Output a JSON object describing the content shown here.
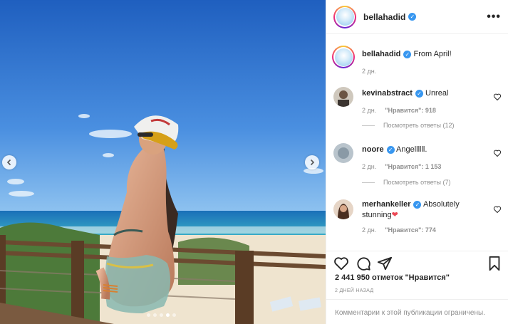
{
  "post": {
    "username": "bellahadid",
    "caption": "From April!",
    "caption_time": "2 дн.",
    "likes": "2 441 950 отметок \"Нравится\"",
    "posted_ago": "2 ДНЕЙ НАЗАД",
    "comments_disabled": "Комментарии к этой публикации ограничены.",
    "carousel": {
      "count": 5,
      "active_index": 3
    }
  },
  "comments": [
    {
      "username": "kevinabstract",
      "text": "Unreal",
      "time": "2 дн.",
      "likes": "\"Нравится\": 918",
      "replies": "Посмотреть ответы (12)"
    },
    {
      "username": "noore",
      "text": "Angellllll.",
      "time": "2 дн.",
      "likes": "\"Нравится\": 1 153",
      "replies": "Посмотреть ответы (7)"
    },
    {
      "username": "merhankeller",
      "text": "Absolutely stunning",
      "emoji": "❤",
      "time": "2 дн.",
      "likes": "\"Нравится\": 774"
    }
  ],
  "icons": {
    "more": "more-options-icon",
    "like": "heart-icon",
    "comment": "comment-icon",
    "share": "share-icon",
    "save": "bookmark-icon",
    "verified": "verified-badge-icon"
  },
  "colors": {
    "verified": "#3897f0",
    "heart_red": "#ed4956",
    "text": "#262626",
    "muted": "#8e8e8e"
  }
}
